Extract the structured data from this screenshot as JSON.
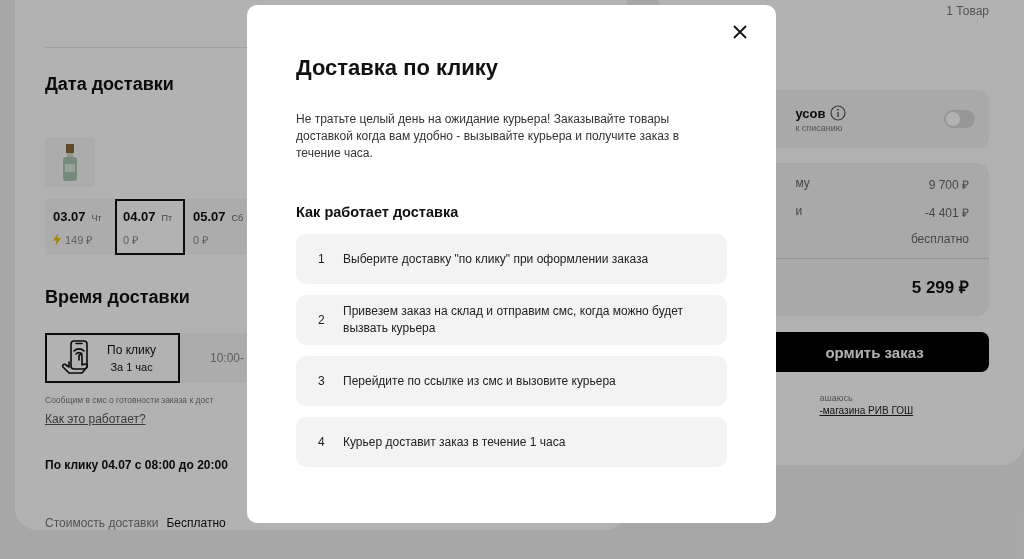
{
  "delivery_date": {
    "title": "Дата доставки",
    "dates": [
      {
        "date": "03.07",
        "weekday": "Чт",
        "price": "149 ₽",
        "express": true,
        "selected": false
      },
      {
        "date": "04.07",
        "weekday": "Пт",
        "price": "0 ₽",
        "express": false,
        "selected": true
      },
      {
        "date": "05.07",
        "weekday": "Сб",
        "price": "0 ₽",
        "express": false,
        "selected": false
      }
    ]
  },
  "delivery_time": {
    "title": "Время доставки",
    "options": [
      {
        "label": "По клику",
        "sublabel": "За 1 час",
        "selected": true
      },
      {
        "label": "10:00-",
        "selected": false
      }
    ],
    "sms_note": "Сообщим в смс о готовности заказа к дост",
    "help_link": "Как это работает?"
  },
  "summary_line": "По клику 04.07 с 08:00 до 20:00",
  "delivery_cost": {
    "label": "Стоимость доставки",
    "value": "Бесплатно"
  },
  "order": {
    "count": "1 Товар",
    "bonus": {
      "title": "усов",
      "note": "к списанию",
      "on": false
    },
    "lines": [
      {
        "label": "му",
        "value": "9 700 ₽"
      },
      {
        "label": "и",
        "value": "-4 401 ₽"
      },
      {
        "value": "бесплатно"
      }
    ],
    "total": "5 299 ₽",
    "button": "ормить заказ",
    "consent": "ашаюсь",
    "consent_link": "-магазина РИВ ГОШ"
  },
  "modal": {
    "title": "Доставка по клику",
    "text": "Не тратьте целый день на ожидание курьера! Заказывайте товары доставкой когда вам удобно - вызывайте курьера и получите заказ в течение часа.",
    "steps_title": "Как работает доставка",
    "steps": [
      {
        "number": "1",
        "text": "Выберите доставку \"по клику\" при оформлении заказа"
      },
      {
        "number": "2",
        "text": "Привезем заказ на склад и отправим смс, когда можно будет вызвать курьера"
      },
      {
        "number": "3",
        "text": "Перейдите по ссылке из смс и вызовите курьера"
      },
      {
        "number": "4",
        "text": "Курьер доставит заказ в течение 1 часа"
      }
    ]
  }
}
